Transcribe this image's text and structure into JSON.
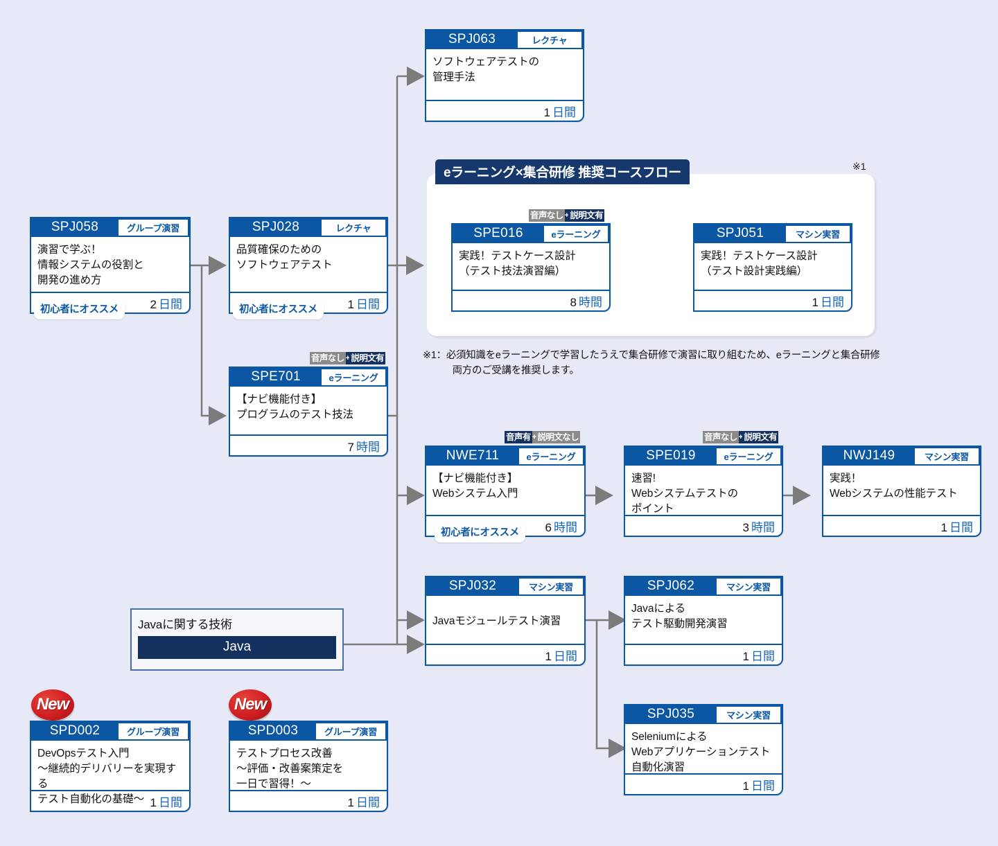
{
  "group": {
    "title": "eラーニング×集合研修 推奨コースフロー",
    "note_mark": "※1",
    "note_text": "※1：必須知識をeラーニングで学習したうえで集合研修で演習に取り組むため、eラーニングと集合研修\n　　　両方のご受講を推奨します。"
  },
  "labels": {
    "beginner_pill": "初心者にオススメ",
    "new_badge": "New"
  },
  "tech": {
    "label": "Javaに関する技術",
    "name": "Java"
  },
  "colors": {
    "background": "#e7eaf6",
    "card_header_blue": "#0b57a4",
    "group_header_navy": "#17386d",
    "unit_blue": "#1565c0",
    "arrow_gray": "#7b7b7b",
    "arrow_navy": "#14467f",
    "new_red": "#cf1f22"
  },
  "cards": [
    {
      "id": "spj063",
      "code": "SPJ063",
      "kind": "レクチャ",
      "title": "ソフトウェアテストの\n管理手法",
      "duration_value": "1",
      "duration_unit": "日間"
    },
    {
      "id": "spj058",
      "code": "SPJ058",
      "kind": "グループ演習",
      "title": "演習で学ぶ！\n情報システムの役割と\n開発の進め方",
      "duration_value": "2",
      "duration_unit": "日間",
      "pill": "初心者にオススメ"
    },
    {
      "id": "spj028",
      "code": "SPJ028",
      "kind": "レクチャ",
      "title": "品質確保のための\nソフトウェアテスト",
      "duration_value": "1",
      "duration_unit": "日間",
      "pill": "初心者にオススメ"
    },
    {
      "id": "spe701",
      "code": "SPE701",
      "kind": "eラーニング",
      "title": "【ナビ機能付き】\nプログラムのテスト技法",
      "duration_value": "7",
      "duration_unit": "時間",
      "atag": {
        "left": "音声なし",
        "left_style": "g",
        "right": "説明文有",
        "right_style": "n"
      }
    },
    {
      "id": "spe016",
      "code": "SPE016",
      "kind": "eラーニング",
      "title": "実践！テストケース設計\n（テスト技法演習編）",
      "duration_value": "8",
      "duration_unit": "時間",
      "atag": {
        "left": "音声なし",
        "left_style": "g",
        "right": "説明文有",
        "right_style": "n"
      }
    },
    {
      "id": "spj051",
      "code": "SPJ051",
      "kind": "マシン実習",
      "title": "実践！テストケース設計\n（テスト設計実践編）",
      "duration_value": "1",
      "duration_unit": "日間"
    },
    {
      "id": "nwe711",
      "code": "NWE711",
      "kind": "eラーニング",
      "title": "【ナビ機能付き】\nWebシステム入門",
      "duration_value": "6",
      "duration_unit": "時間",
      "pill": "初心者にオススメ",
      "atag": {
        "left": "音声有",
        "left_style": "n",
        "right": "説明文なし",
        "right_style": "g"
      }
    },
    {
      "id": "spe019",
      "code": "SPE019",
      "kind": "eラーニング",
      "title": "速習!\nWebシステムテストの\nポイント",
      "duration_value": "3",
      "duration_unit": "時間",
      "atag": {
        "left": "音声なし",
        "left_style": "g",
        "right": "説明文有",
        "right_style": "n"
      }
    },
    {
      "id": "nwj149",
      "code": "NWJ149",
      "kind": "マシン実習",
      "title": "実践！\nWebシステムの性能テスト",
      "duration_value": "1",
      "duration_unit": "日間"
    },
    {
      "id": "spj032",
      "code": "SPJ032",
      "kind": "マシン実習",
      "title": "Javaモジュールテスト演習",
      "duration_value": "1",
      "duration_unit": "日間"
    },
    {
      "id": "spj062",
      "code": "SPJ062",
      "kind": "マシン実習",
      "title": "Javaによる\nテスト駆動開発演習",
      "duration_value": "1",
      "duration_unit": "日間"
    },
    {
      "id": "spj035",
      "code": "SPJ035",
      "kind": "マシン実習",
      "title": "Seleniumによる\nWebアプリケーションテスト\n自動化演習",
      "duration_value": "1",
      "duration_unit": "日間"
    },
    {
      "id": "spd002",
      "code": "SPD002",
      "kind": "グループ演習",
      "title": "DevOpsテスト入門\n〜継続的デリバリーを実現する\nテスト自動化の基礎〜",
      "duration_value": "1",
      "duration_unit": "日間",
      "new": "New"
    },
    {
      "id": "spd003",
      "code": "SPD003",
      "kind": "グループ演習",
      "title": "テストプロセス改善\n〜評価・改善案策定を\n一日で習得！〜",
      "duration_value": "1",
      "duration_unit": "日間",
      "new": "New"
    }
  ]
}
